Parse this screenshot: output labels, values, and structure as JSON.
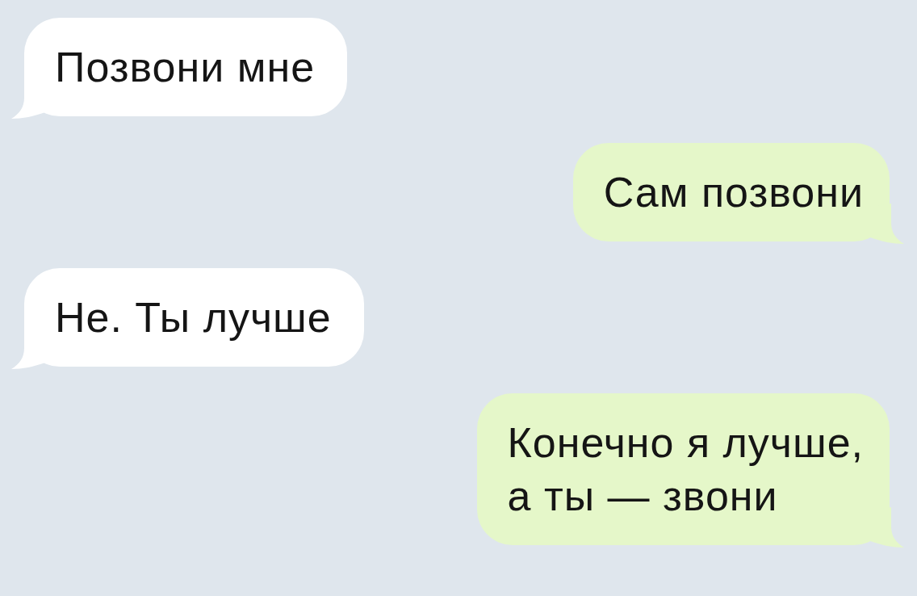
{
  "chat": {
    "messages": [
      {
        "kind": "incoming",
        "text": "Позвони мне"
      },
      {
        "kind": "outgoing",
        "text": "Сам позвони"
      },
      {
        "kind": "incoming",
        "text": "Не. Ты лучше"
      },
      {
        "kind": "outgoing",
        "text": "Конечно я лучше,\nа ты — звони"
      }
    ]
  }
}
